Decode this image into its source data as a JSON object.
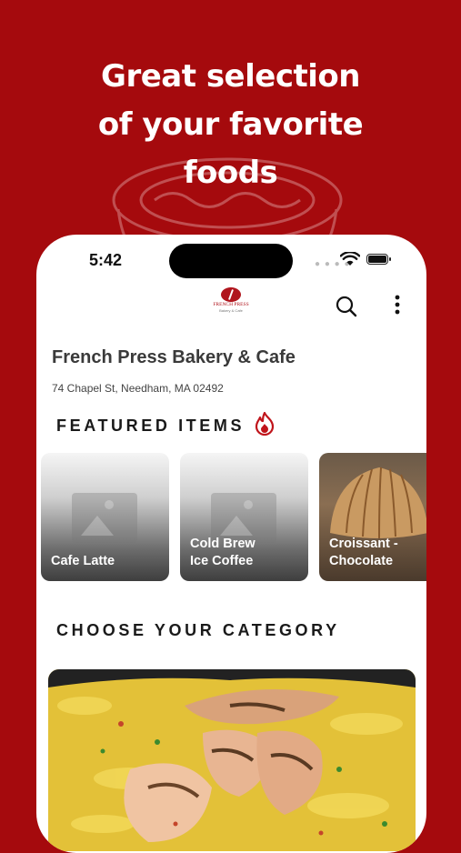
{
  "headline": {
    "line1": "Great selection",
    "line2": "of your favorite",
    "line3": "foods"
  },
  "status_bar": {
    "time": "5:42"
  },
  "app": {
    "logo_name": "FRENCH PRESS",
    "logo_sub": "Bakery & Cafe",
    "shop_name": "French Press Bakery & Cafe",
    "address": "74 Chapel St, Needham, MA 02492"
  },
  "featured": {
    "title": "FEATURED ITEMS",
    "items": [
      {
        "line1": "Cafe Latte",
        "line2": ""
      },
      {
        "line1": "Cold Brew",
        "line2": "Ice Coffee"
      },
      {
        "line1": "Croissant -",
        "line2": "Chocolate"
      }
    ]
  },
  "category": {
    "title": "CHOOSE YOUR CATEGORY"
  },
  "colors": {
    "brand_red": "#a50a0d",
    "logo_red": "#b0151d"
  },
  "icons": [
    "search-icon",
    "more-vertical-icon",
    "fire-icon",
    "wifi-icon",
    "battery-icon",
    "image-placeholder-icon"
  ]
}
